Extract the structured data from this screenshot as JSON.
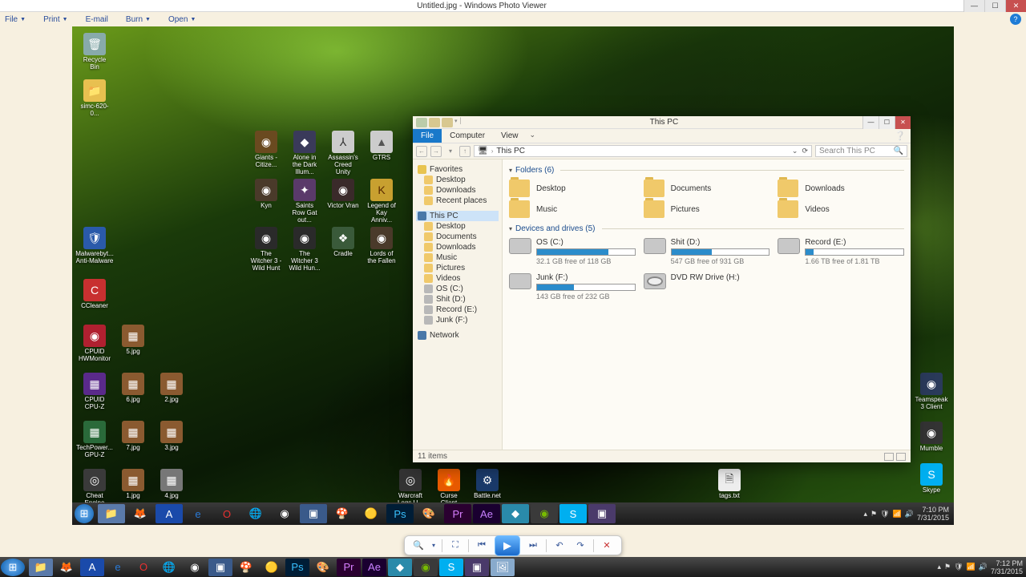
{
  "photoViewer": {
    "title": "Untitled.jpg - Windows Photo Viewer",
    "menus": {
      "file": "File",
      "print": "Print",
      "email": "E-mail",
      "burn": "Burn",
      "open": "Open"
    }
  },
  "desktopLeft": {
    "recycle": "Recycle Bin",
    "simc": "simc-620-0...",
    "malware": "Malwarebyt... Anti-Malware",
    "ccleaner": "CCleaner",
    "hwmon": "CPUID HWMonitor",
    "i5": "5.jpg",
    "cpuz": "CPUID CPU-Z",
    "i6": "6.jpg",
    "i2": "2.jpg",
    "gpuz": "TechPower... GPU-Z",
    "i7": "7.jpg",
    "i3": "3.jpg",
    "cheat": "Cheat Engine",
    "i1": "1.jpg",
    "i4": "4.jpg"
  },
  "games": {
    "r1": {
      "a": "Giants - Citize...",
      "b": "Alone in the Dark Illum...",
      "c": "Assassin's Creed Unity",
      "d": "GTRS"
    },
    "r2": {
      "a": "Kyn",
      "b": "Saints Row Gat out...",
      "c": "Victor Vran",
      "d": "Legend of Kay Anniv..."
    },
    "r3": {
      "a": "The Witcher 3 - Wild Hunt",
      "b": "The Witcher 3 Wild Hun...",
      "c": "Cradle",
      "d": "Lords of the Fallen"
    }
  },
  "bottomIcons": {
    "warcraft": "Warcraft Logs U...",
    "curse": "Curse Client",
    "bnet": "Battle.net",
    "tags": "tags.txt"
  },
  "rightIcons": {
    "ts": "Teamspeak 3 Client",
    "mumble": "Mumble",
    "skype": "Skype"
  },
  "explorer": {
    "title": "This PC",
    "tabs": {
      "file": "File",
      "computer": "Computer",
      "view": "View"
    },
    "breadcrumb": "This PC",
    "searchPlaceholder": "Search This PC",
    "nav": {
      "fav": "Favorites",
      "desk": "Desktop",
      "dl": "Downloads",
      "recent": "Recent places",
      "pc": "This PC",
      "desk2": "Desktop",
      "docs": "Documents",
      "dl2": "Downloads",
      "music": "Music",
      "pics": "Pictures",
      "vids": "Videos",
      "dC": "OS (C:)",
      "dD": "Shit (D:)",
      "dE": "Record (E:)",
      "dF": "Junk (F:)",
      "net": "Network"
    },
    "groups": {
      "folders": "Folders (6)",
      "drives": "Devices and drives (5)"
    },
    "folders": {
      "desk": "Desktop",
      "docs": "Documents",
      "dl": "Downloads",
      "music": "Music",
      "pics": "Pictures",
      "vids": "Videos"
    },
    "drives": {
      "c": {
        "name": "OS (C:)",
        "free": "32.1 GB free of 118 GB",
        "pct": 73
      },
      "d": {
        "name": "Shit (D:)",
        "free": "547 GB free of 931 GB",
        "pct": 41
      },
      "e": {
        "name": "Record (E:)",
        "free": "1.66 TB free of 1.81 TB",
        "pct": 8
      },
      "f": {
        "name": "Junk (F:)",
        "free": "143 GB free of 232 GB",
        "pct": 38
      },
      "h": {
        "name": "DVD RW Drive (H:)"
      }
    },
    "status": "11 items"
  },
  "innerClock": {
    "time": "7:10 PM",
    "date": "7/31/2015"
  },
  "hostClock": {
    "time": "7:12 PM",
    "date": "7/31/2015"
  }
}
